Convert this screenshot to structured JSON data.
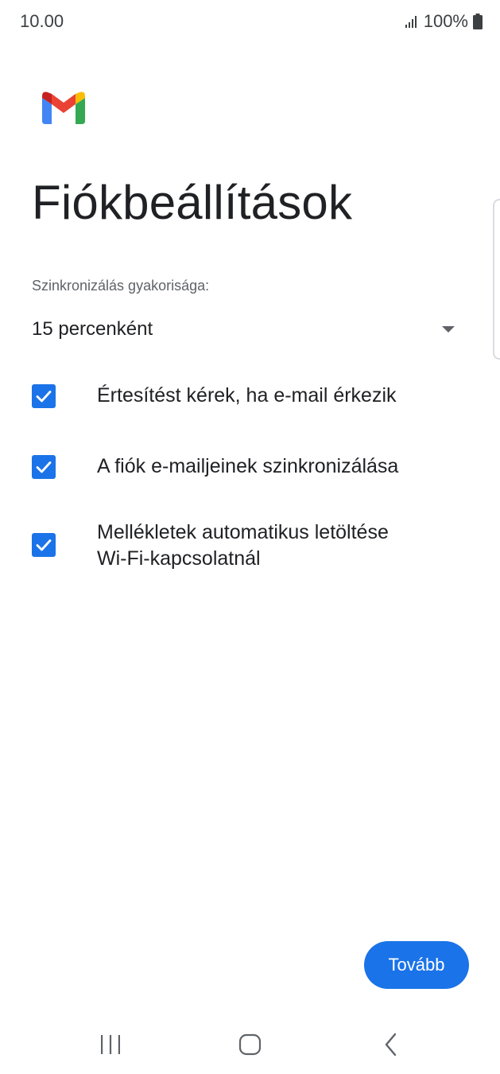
{
  "status_bar": {
    "time": "10.00",
    "battery_text": "100%",
    "signal_icon": "signal-icon",
    "battery_icon": "battery-icon"
  },
  "logo": {
    "icon": "gmail-logo",
    "colors": [
      "#ea4335",
      "#c5221f",
      "#4285f4",
      "#34a853",
      "#fbbc04"
    ]
  },
  "header": {
    "title": "Fiókbeállítások"
  },
  "sync": {
    "label": "Szinkronizálás gyakorisága:",
    "selected": "15 percenként"
  },
  "options": [
    {
      "label": "Értesítést kérek, ha e-mail érkezik",
      "checked": true
    },
    {
      "label": "A fiók e-mailjeinek szinkronizálása",
      "checked": true
    },
    {
      "label_line1": "Mellékletek automatikus letöltése",
      "label_line2": "Wi-Fi-kapcsolatnál",
      "checked": true
    }
  ],
  "actions": {
    "next_label": "Tovább"
  },
  "colors": {
    "accent": "#1a73e8",
    "text_primary": "#202124",
    "text_secondary": "#5f6368"
  },
  "nav_bar": {
    "recents_icon": "recents-icon",
    "home_icon": "home-icon",
    "back_icon": "back-icon"
  }
}
